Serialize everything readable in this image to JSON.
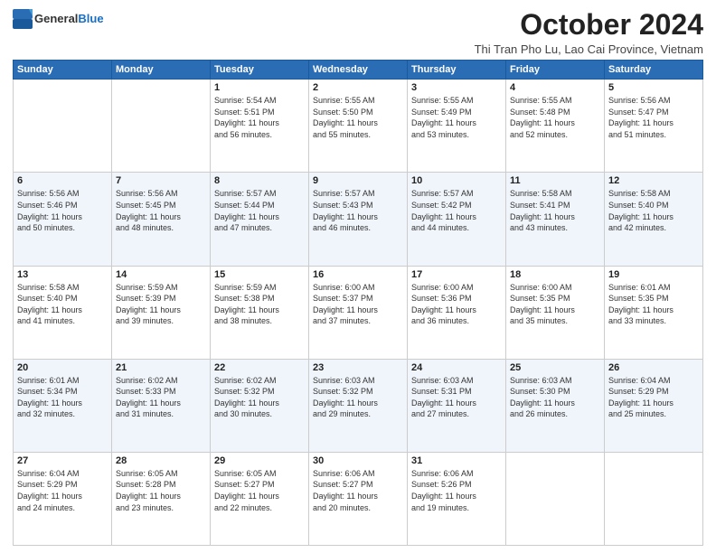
{
  "header": {
    "logo_general": "General",
    "logo_blue": "Blue",
    "month_title": "October 2024",
    "location": "Thi Tran Pho Lu, Lao Cai Province, Vietnam"
  },
  "days_of_week": [
    "Sunday",
    "Monday",
    "Tuesday",
    "Wednesday",
    "Thursday",
    "Friday",
    "Saturday"
  ],
  "weeks": [
    [
      {
        "day": "",
        "info": ""
      },
      {
        "day": "",
        "info": ""
      },
      {
        "day": "1",
        "info": "Sunrise: 5:54 AM\nSunset: 5:51 PM\nDaylight: 11 hours\nand 56 minutes."
      },
      {
        "day": "2",
        "info": "Sunrise: 5:55 AM\nSunset: 5:50 PM\nDaylight: 11 hours\nand 55 minutes."
      },
      {
        "day": "3",
        "info": "Sunrise: 5:55 AM\nSunset: 5:49 PM\nDaylight: 11 hours\nand 53 minutes."
      },
      {
        "day": "4",
        "info": "Sunrise: 5:55 AM\nSunset: 5:48 PM\nDaylight: 11 hours\nand 52 minutes."
      },
      {
        "day": "5",
        "info": "Sunrise: 5:56 AM\nSunset: 5:47 PM\nDaylight: 11 hours\nand 51 minutes."
      }
    ],
    [
      {
        "day": "6",
        "info": "Sunrise: 5:56 AM\nSunset: 5:46 PM\nDaylight: 11 hours\nand 50 minutes."
      },
      {
        "day": "7",
        "info": "Sunrise: 5:56 AM\nSunset: 5:45 PM\nDaylight: 11 hours\nand 48 minutes."
      },
      {
        "day": "8",
        "info": "Sunrise: 5:57 AM\nSunset: 5:44 PM\nDaylight: 11 hours\nand 47 minutes."
      },
      {
        "day": "9",
        "info": "Sunrise: 5:57 AM\nSunset: 5:43 PM\nDaylight: 11 hours\nand 46 minutes."
      },
      {
        "day": "10",
        "info": "Sunrise: 5:57 AM\nSunset: 5:42 PM\nDaylight: 11 hours\nand 44 minutes."
      },
      {
        "day": "11",
        "info": "Sunrise: 5:58 AM\nSunset: 5:41 PM\nDaylight: 11 hours\nand 43 minutes."
      },
      {
        "day": "12",
        "info": "Sunrise: 5:58 AM\nSunset: 5:40 PM\nDaylight: 11 hours\nand 42 minutes."
      }
    ],
    [
      {
        "day": "13",
        "info": "Sunrise: 5:58 AM\nSunset: 5:40 PM\nDaylight: 11 hours\nand 41 minutes."
      },
      {
        "day": "14",
        "info": "Sunrise: 5:59 AM\nSunset: 5:39 PM\nDaylight: 11 hours\nand 39 minutes."
      },
      {
        "day": "15",
        "info": "Sunrise: 5:59 AM\nSunset: 5:38 PM\nDaylight: 11 hours\nand 38 minutes."
      },
      {
        "day": "16",
        "info": "Sunrise: 6:00 AM\nSunset: 5:37 PM\nDaylight: 11 hours\nand 37 minutes."
      },
      {
        "day": "17",
        "info": "Sunrise: 6:00 AM\nSunset: 5:36 PM\nDaylight: 11 hours\nand 36 minutes."
      },
      {
        "day": "18",
        "info": "Sunrise: 6:00 AM\nSunset: 5:35 PM\nDaylight: 11 hours\nand 35 minutes."
      },
      {
        "day": "19",
        "info": "Sunrise: 6:01 AM\nSunset: 5:35 PM\nDaylight: 11 hours\nand 33 minutes."
      }
    ],
    [
      {
        "day": "20",
        "info": "Sunrise: 6:01 AM\nSunset: 5:34 PM\nDaylight: 11 hours\nand 32 minutes."
      },
      {
        "day": "21",
        "info": "Sunrise: 6:02 AM\nSunset: 5:33 PM\nDaylight: 11 hours\nand 31 minutes."
      },
      {
        "day": "22",
        "info": "Sunrise: 6:02 AM\nSunset: 5:32 PM\nDaylight: 11 hours\nand 30 minutes."
      },
      {
        "day": "23",
        "info": "Sunrise: 6:03 AM\nSunset: 5:32 PM\nDaylight: 11 hours\nand 29 minutes."
      },
      {
        "day": "24",
        "info": "Sunrise: 6:03 AM\nSunset: 5:31 PM\nDaylight: 11 hours\nand 27 minutes."
      },
      {
        "day": "25",
        "info": "Sunrise: 6:03 AM\nSunset: 5:30 PM\nDaylight: 11 hours\nand 26 minutes."
      },
      {
        "day": "26",
        "info": "Sunrise: 6:04 AM\nSunset: 5:29 PM\nDaylight: 11 hours\nand 25 minutes."
      }
    ],
    [
      {
        "day": "27",
        "info": "Sunrise: 6:04 AM\nSunset: 5:29 PM\nDaylight: 11 hours\nand 24 minutes."
      },
      {
        "day": "28",
        "info": "Sunrise: 6:05 AM\nSunset: 5:28 PM\nDaylight: 11 hours\nand 23 minutes."
      },
      {
        "day": "29",
        "info": "Sunrise: 6:05 AM\nSunset: 5:27 PM\nDaylight: 11 hours\nand 22 minutes."
      },
      {
        "day": "30",
        "info": "Sunrise: 6:06 AM\nSunset: 5:27 PM\nDaylight: 11 hours\nand 20 minutes."
      },
      {
        "day": "31",
        "info": "Sunrise: 6:06 AM\nSunset: 5:26 PM\nDaylight: 11 hours\nand 19 minutes."
      },
      {
        "day": "",
        "info": ""
      },
      {
        "day": "",
        "info": ""
      }
    ]
  ]
}
